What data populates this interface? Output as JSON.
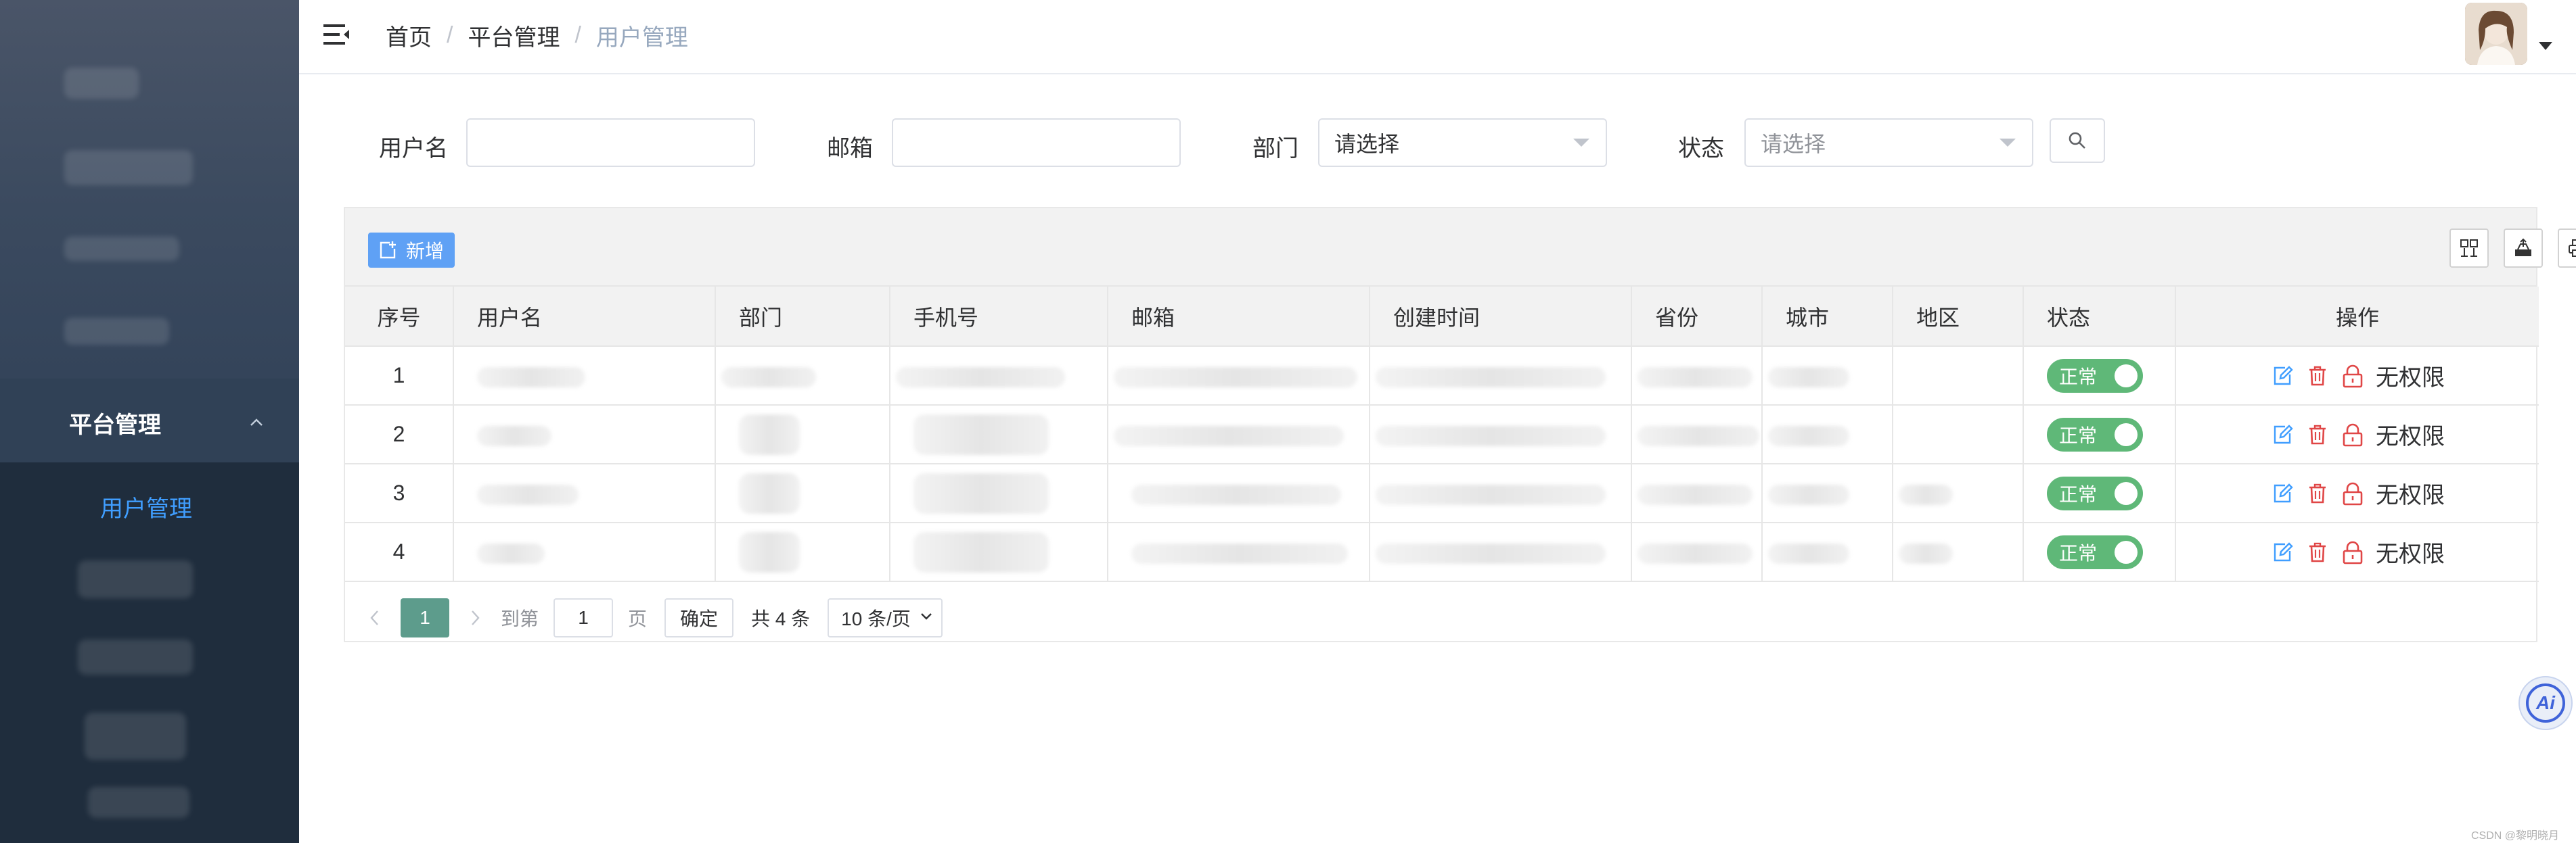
{
  "sidebar": {
    "menu_parent": "平台管理",
    "menu_child": "用户管理"
  },
  "header": {
    "breadcrumb": [
      "首页",
      "平台管理",
      "用户管理"
    ],
    "separator": "/"
  },
  "filters": {
    "username_label": "用户名",
    "username_value": "",
    "email_label": "邮箱",
    "email_value": "",
    "dept_label": "部门",
    "dept_value": "请选择",
    "status_label": "状态",
    "status_placeholder": "请选择"
  },
  "toolbar": {
    "add_label": "新增",
    "tools": [
      "columns-icon",
      "export-icon",
      "print-icon"
    ]
  },
  "table": {
    "columns": [
      "序号",
      "用户名",
      "部门",
      "手机号",
      "邮箱",
      "创建时间",
      "省份",
      "城市",
      "地区",
      "状态",
      "操作"
    ],
    "rows": [
      {
        "index": "1",
        "status": "正常",
        "perm": "无权限"
      },
      {
        "index": "2",
        "status": "正常",
        "perm": "无权限"
      },
      {
        "index": "3",
        "status": "正常",
        "perm": "无权限"
      },
      {
        "index": "4",
        "status": "正常",
        "perm": "无权限"
      }
    ]
  },
  "pagination": {
    "current": "1",
    "goto_label": "到第",
    "goto_value": "1",
    "page_label": "页",
    "confirm_label": "确定",
    "total_label": "共 4 条",
    "page_size": "10 条/页"
  },
  "ai_label": "Ai",
  "watermark": "CSDN @黎明晓月",
  "colors": {
    "sidebar": "#304156",
    "submenu": "#1f2d3d",
    "active_link": "#409eff",
    "switch_on": "#5fb878",
    "primary_btn": "#5fa1f5",
    "page_current": "#5d9c8c",
    "delete_icon": "#e04646",
    "edit_icon": "#409eff"
  }
}
